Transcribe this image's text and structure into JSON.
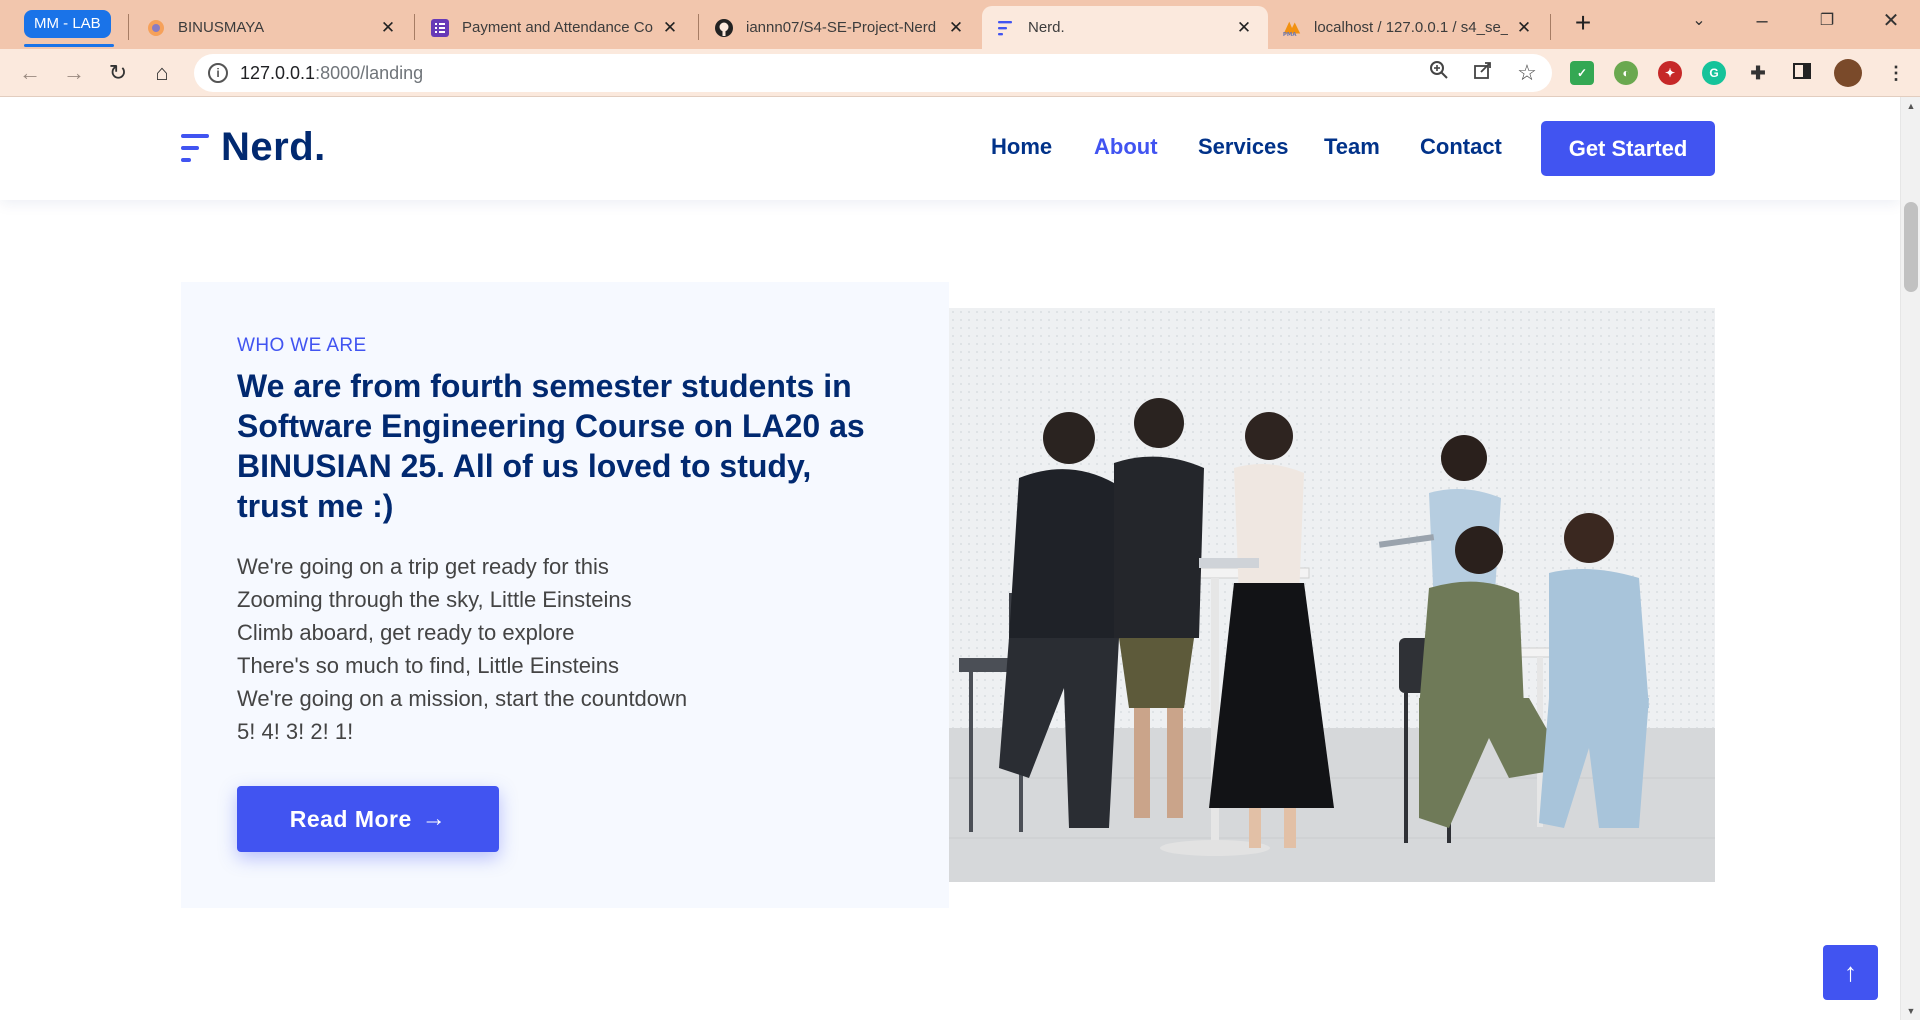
{
  "browser": {
    "tab_group": "MM - LAB",
    "tabs": [
      {
        "title": "BINUSMAYA",
        "active": false
      },
      {
        "title": "Payment and Attendance Cor",
        "active": false
      },
      {
        "title": "iannn07/S4-SE-Project-Nerd",
        "active": false
      },
      {
        "title": "Nerd.",
        "active": true
      },
      {
        "title": "localhost / 127.0.0.1 / s4_se_",
        "active": false
      }
    ],
    "url_host": "127.0.0.1",
    "url_rest": ":8000/landing"
  },
  "header": {
    "logo": "Nerd.",
    "nav": [
      "Home",
      "About",
      "Services",
      "Team",
      "Contact"
    ],
    "active_nav": "About",
    "cta": "Get Started"
  },
  "about": {
    "eyebrow": "WHO WE ARE",
    "headline": "We are from fourth semester students in Software Engineering Course on LA20 as BINUSIAN 25. All of us loved to study, trust me :)",
    "lyrics": [
      "We're going on a trip get ready for this",
      "Zooming through the sky, Little Einsteins",
      "Climb aboard, get ready to explore",
      "There's so much to find, Little Einsteins",
      "We're going on a mission, start the countdown",
      "5! 4! 3! 2! 1!"
    ],
    "button": "Read More",
    "image_alt": "students-group-photo"
  },
  "colors": {
    "accent": "#4154f1",
    "navy": "#012970",
    "about_bg": "#f6f9ff",
    "tab_strip": "#f2c6ad",
    "toolbar": "#fbe9dd"
  },
  "icons": {
    "back_to_top": "arrow-up-icon",
    "read_more": "arrow-right-icon"
  }
}
